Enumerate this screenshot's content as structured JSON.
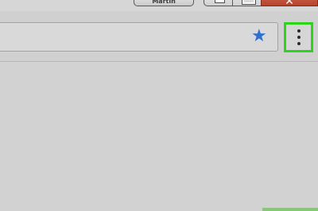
{
  "window": {
    "profile_label": "Martin",
    "minimize_icon": "minimize-icon",
    "maximize_icon": "maximize-icon",
    "close_icon": "close-icon",
    "close_color": "#c9553c"
  },
  "toolbar": {
    "address_value": "",
    "bookmark_icon": "star-icon",
    "bookmark_color": "#2e6fd0",
    "menu_icon": "three-dots-vertical-icon",
    "menu_highlight_color": "#2bd51a"
  }
}
